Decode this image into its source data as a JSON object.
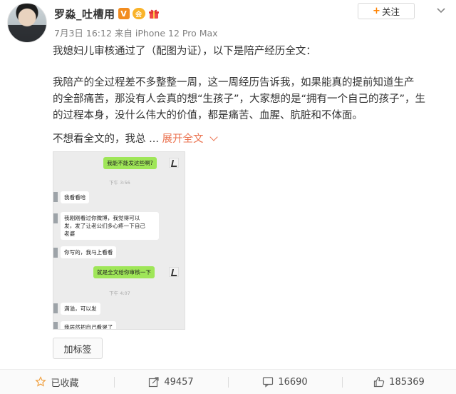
{
  "user": {
    "name": "罗淼_吐槽用",
    "badges": {
      "verified": "V",
      "vip": "会"
    },
    "meta": "7月3日 16:12 来自 iPhone 12 Pro Max"
  },
  "header": {
    "follow_label": "关注"
  },
  "post": {
    "line1": "我媳妇儿审核通过了（配图为证），以下是陪产经历全文：",
    "para2_l1": "我陪产的全过程差不多整整一周，这一周经历告诉我，如果能真的提前知道生产",
    "para2_l2": "的全部痛苦，那没有人会真的想“生孩子”，大家想的是“拥有一个自己的孩子”，生",
    "para2_l3": "的过程本身，没什么伟大的价值，都是痛苦、血腥、肮脏和不体面。",
    "line_last": "不想看全文的，我总 ...",
    "expand_label": "展开全文"
  },
  "chat": {
    "msg1": "我能不能发这些啊?",
    "time1": "下午 3:56",
    "msg2": "我看看哈",
    "msg3_l1": "我刚刚看过你微博，我觉得可以",
    "msg3_l2": "发，发了让老公们多心疼一下自己",
    "msg3_l3": "老婆",
    "msg4": "你写的，我马上看看",
    "msg5": "就是全文给你审核一下",
    "time2": "下午 4:07",
    "msg6": "满溢，可以发",
    "msg7": "我居然把自己看哭了"
  },
  "tag_button": "加标签",
  "actions": {
    "favorite": "已收藏",
    "repost": "49457",
    "comment": "16690",
    "like": "185369"
  },
  "colors": {
    "accent": "#ff8200",
    "link": "#eb7350",
    "bubble_green": "#9fe658"
  }
}
